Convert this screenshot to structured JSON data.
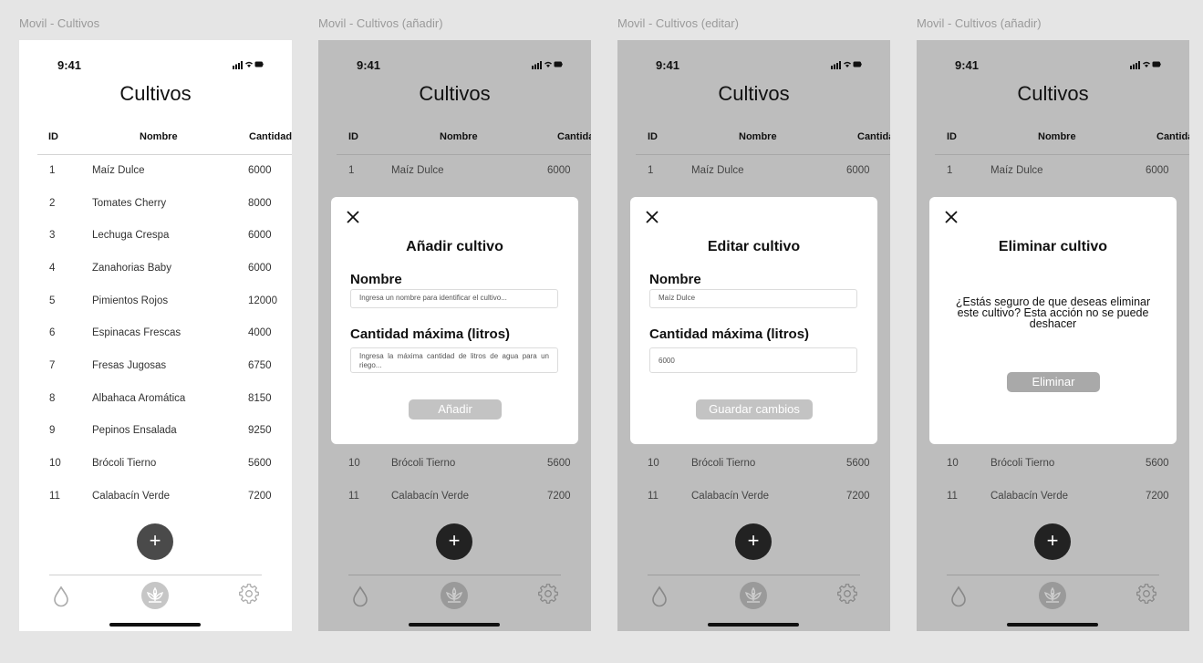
{
  "frames": [
    {
      "label": "Movil - Cultivos"
    },
    {
      "label": "Movil - Cultivos (añadir)"
    },
    {
      "label": "Movil - Cultivos (editar)"
    },
    {
      "label": "Movil - Cultivos (añadir)"
    }
  ],
  "status": {
    "time": "9:41"
  },
  "screen": {
    "title": "Cultivos"
  },
  "table": {
    "headers": {
      "id": "ID",
      "name": "Nombre",
      "qty": "Cantidad"
    },
    "rows": [
      {
        "id": "1",
        "name": "Maíz Dulce",
        "qty": "6000"
      },
      {
        "id": "2",
        "name": "Tomates Cherry",
        "qty": "8000"
      },
      {
        "id": "3",
        "name": "Lechuga Crespa",
        "qty": "6000"
      },
      {
        "id": "4",
        "name": "Zanahorias Baby",
        "qty": "6000"
      },
      {
        "id": "5",
        "name": "Pimientos Rojos",
        "qty": "12000"
      },
      {
        "id": "6",
        "name": "Espinacas Frescas",
        "qty": "4000"
      },
      {
        "id": "7",
        "name": "Fresas Jugosas",
        "qty": "6750"
      },
      {
        "id": "8",
        "name": "Albahaca Aromática",
        "qty": "8150"
      },
      {
        "id": "9",
        "name": "Pepinos Ensalada",
        "qty": "9250"
      },
      {
        "id": "10",
        "name": "Brócoli Tierno",
        "qty": "5600"
      },
      {
        "id": "11",
        "name": "Calabacín Verde",
        "qty": "7200"
      }
    ]
  },
  "fab": {
    "label": "+"
  },
  "add_modal": {
    "title": "Añadir cultivo",
    "name_label": "Nombre",
    "name_placeholder": "Ingresa un nombre para identificar el cultivo...",
    "qty_label": "Cantidad máxima (litros)",
    "qty_placeholder": "Ingresa la máxima cantidad de litros de agua para un riego...",
    "button": "Añadir"
  },
  "edit_modal": {
    "title": "Editar cultivo",
    "name_label": "Nombre",
    "name_value": "Maíz Dulce",
    "qty_label": "Cantidad máxima (litros)",
    "qty_value": "6000",
    "button": "Guardar cambios"
  },
  "delete_modal": {
    "title": "Eliminar cultivo",
    "message": "¿Estás seguro de que deseas eliminar este cultivo? Esta acción no se puede deshacer",
    "button": "Eliminar"
  },
  "icons": {
    "water": "water-drop-icon",
    "plant": "plant-icon",
    "settings": "gear-icon",
    "close": "close-icon"
  }
}
